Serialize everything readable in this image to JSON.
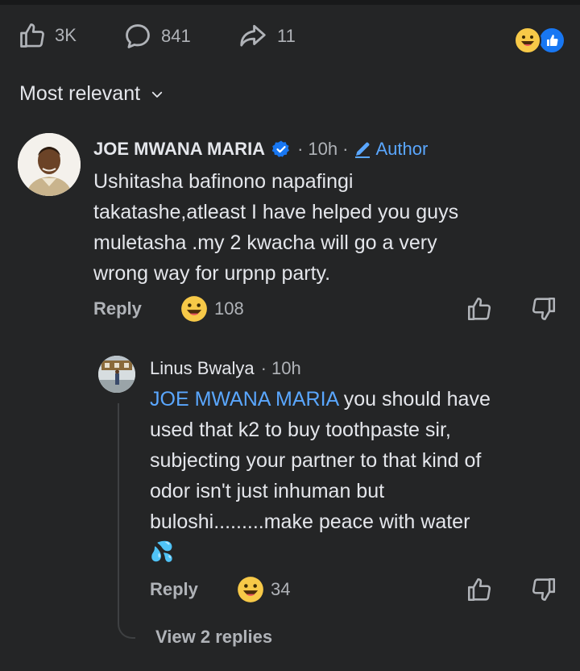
{
  "stats": {
    "likes": "3K",
    "comments": "841",
    "shares": "11"
  },
  "sort": {
    "label": "Most relevant"
  },
  "comment": {
    "name": "JOE MWANA MARIA",
    "time": "10h",
    "author_label": "Author",
    "text_lines": [
      "Ushitasha bafinono napafingi",
      "takatashe,atleast I have helped you guys",
      "muletasha .my 2 kwacha will go a very",
      "wrong way for urpnp party."
    ],
    "reply_label": "Reply",
    "reaction_count": "108"
  },
  "reply": {
    "name": "Linus Bwalya",
    "time": "10h",
    "mention": "JOE MWANA MARIA",
    "first_line_rest": " you should have",
    "text_lines": [
      "used that k2 to buy toothpaste sir,",
      "subjecting your partner to that kind of",
      "odor isn't  just inhuman but",
      "buloshi.........make peace with water"
    ],
    "emoji": "💦",
    "reply_label": "Reply",
    "reaction_count": "34"
  },
  "view_replies": "View 2 replies",
  "colors": {
    "background": "#242526",
    "text": "#e4e6eb",
    "muted": "#b0b3b8",
    "link": "#5aa7ff",
    "like_blue": "#1877f2",
    "haha_yellow": "#f7c948"
  }
}
